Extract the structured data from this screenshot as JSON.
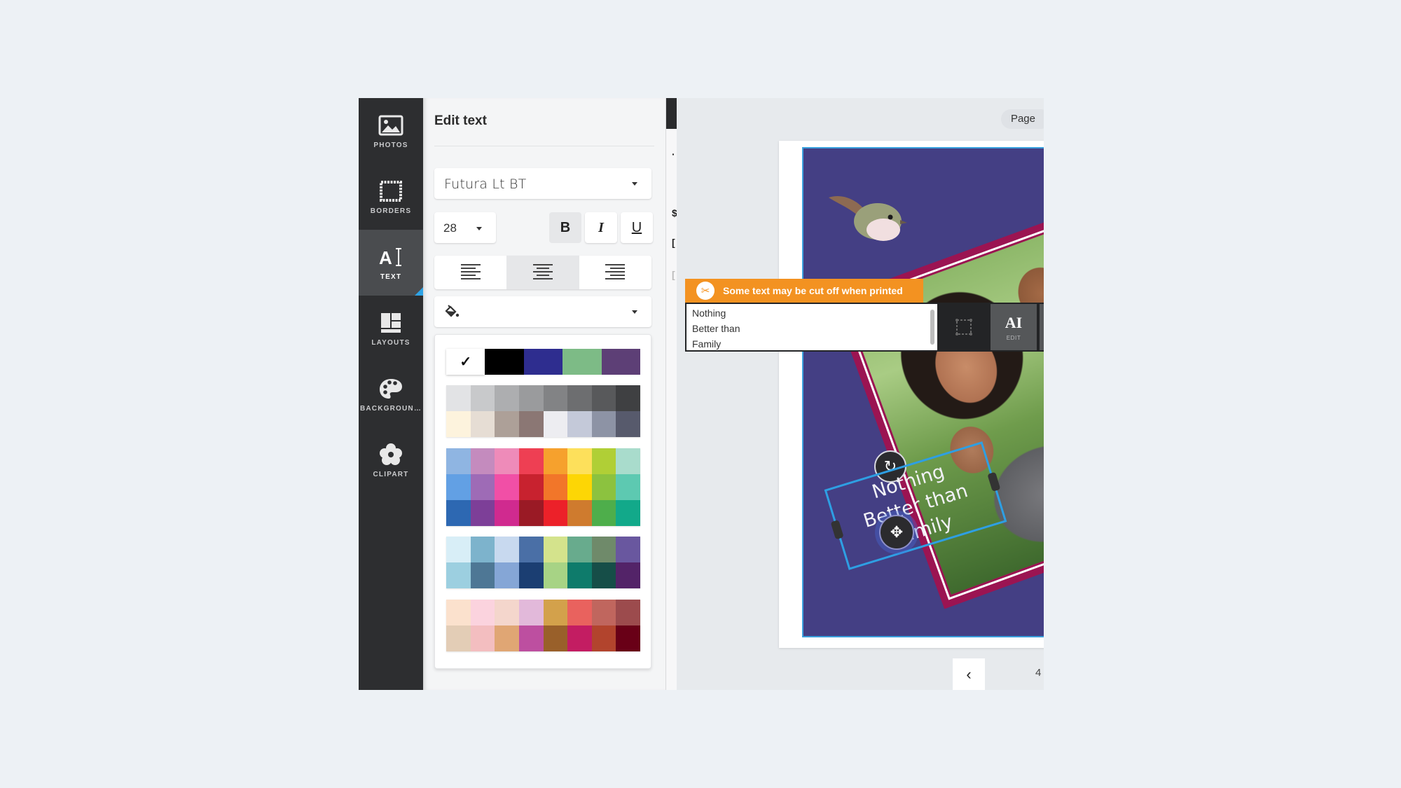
{
  "sidebar": {
    "items": [
      {
        "label": "PHOTOS",
        "icon": "photo-icon",
        "active": false
      },
      {
        "label": "BORDERS",
        "icon": "border-icon",
        "active": false
      },
      {
        "label": "TEXT",
        "icon": "text-icon",
        "active": true
      },
      {
        "label": "LAYOUTS",
        "icon": "layout-icon",
        "active": false
      },
      {
        "label": "BACKGROUN…",
        "icon": "palette-icon",
        "active": false
      },
      {
        "label": "CLIPART",
        "icon": "flower-icon",
        "active": false
      }
    ]
  },
  "edit_panel": {
    "title": "Edit text",
    "font_family": "Futura Lt BT",
    "font_size": "28",
    "bold_label": "B",
    "italic_label": "I",
    "underline_label": "U",
    "bold_active": true,
    "italic_active": false,
    "underline_active": false,
    "alignment": "center",
    "color_select_icon": "paint-bucket-icon"
  },
  "palette": {
    "selected": "#ffffff",
    "top_row": [
      "#ffffff",
      "#000000",
      "#2e2d8f",
      "#7dbb86",
      "#5d3f76"
    ],
    "block1": [
      "#e2e3e5",
      "#c8c9cb",
      "#adaeb0",
      "#9a9b9d",
      "#828385",
      "#6d6e70",
      "#58595b",
      "#3f4042",
      "#fdf3dd",
      "#e6ddd4",
      "#ada098",
      "#8b7774",
      "#ededf1",
      "#c4c9d9",
      "#8d93a5",
      "#575a6c"
    ],
    "block2": [
      "#8fb5e2",
      "#c48bbe",
      "#ee8bb9",
      "#ee3f53",
      "#f6a12d",
      "#fde05b",
      "#b0cf36",
      "#a9dccc",
      "#62a0e4",
      "#9e6bb6",
      "#f14fa6",
      "#c8222f",
      "#f27629",
      "#fdd605",
      "#8cc23f",
      "#5dc9b1",
      "#2d68b2",
      "#7d3f98",
      "#d02a8f",
      "#9a1a25",
      "#ec2129",
      "#cf7b2e",
      "#4eae4b",
      "#12a98a"
    ],
    "block3": [
      "#d8eef7",
      "#7db3cc",
      "#c8d9ef",
      "#4a6fa6",
      "#d4e38c",
      "#68ab8d",
      "#6f8a6a",
      "#69579f",
      "#9ccfe0",
      "#4e7795",
      "#85a6d6",
      "#1b3e72",
      "#a7d385",
      "#0e7b6b",
      "#164e48",
      "#532368"
    ],
    "block4": [
      "#fbe1cd",
      "#fbd3de",
      "#f4d6cc",
      "#e2b9da",
      "#d3a14b",
      "#e9625e",
      "#c0665e",
      "#9c4b4d",
      "#e3cdb6",
      "#f3bec0",
      "#e0a674",
      "#bd4fa0",
      "#99602a",
      "#c31d62",
      "#b2442d",
      "#690017"
    ]
  },
  "canvas": {
    "page_chip": "Page",
    "warning": "Some text may be cut off when printed",
    "warning_icon": "scissors-icon",
    "text_lines": [
      "Nothing",
      "Better than",
      "Family"
    ],
    "toolbar_edit_label": "EDIT",
    "page_number": "4",
    "background_color": "#443f84",
    "frame_color": "#9b1452"
  }
}
